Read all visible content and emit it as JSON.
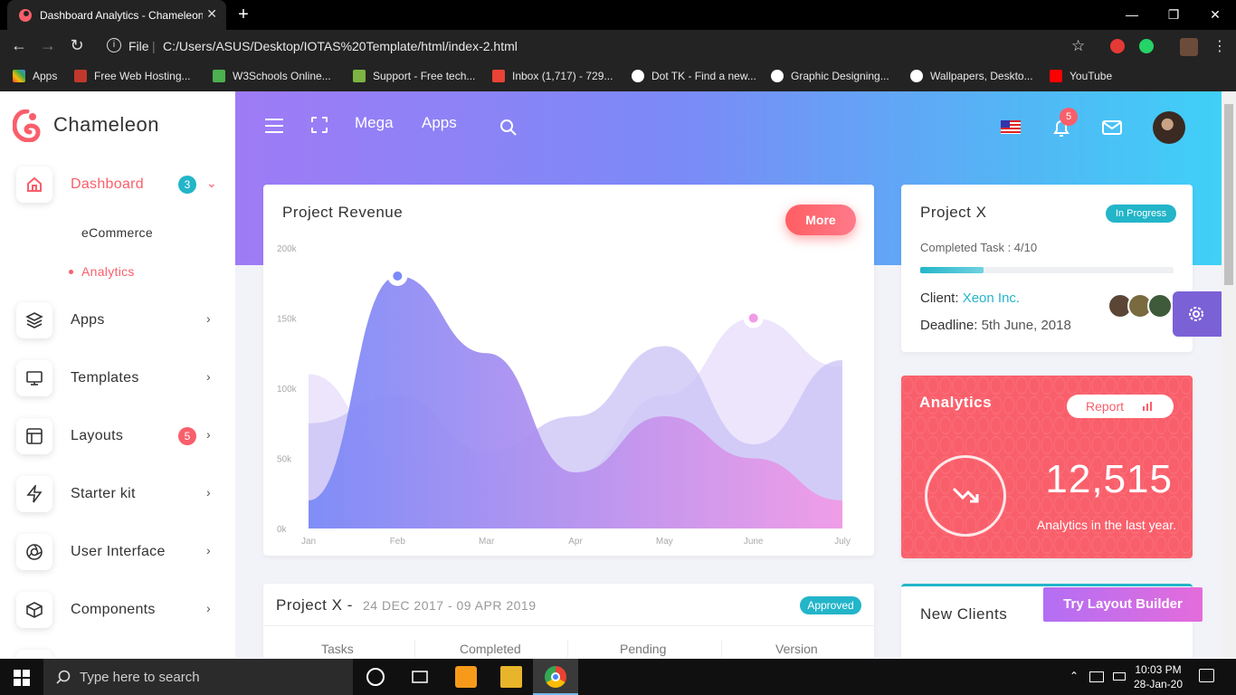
{
  "browser": {
    "tab_title": "Dashboard Analytics - Chameleon",
    "new_tab": "+",
    "close_tab": "✕",
    "omnibox_scheme": "File",
    "omnibox_url": "C:/Users/ASUS/Desktop/IOTAS%20Template/html/index-2.html",
    "bookmarks": [
      "Apps",
      "Free Web Hosting...",
      "W3Schools Online...",
      "Support - Free tech...",
      "Inbox (1,717) - 729...",
      "Dot TK - Find a new...",
      "Graphic Designing...",
      "Wallpapers, Deskto...",
      "YouTube"
    ]
  },
  "sidebar": {
    "brand": "Chameleon",
    "items": [
      {
        "label": "Dashboard",
        "badge": "3",
        "icon": "home-icon",
        "active": true
      },
      {
        "label": "Apps",
        "icon": "layers-icon"
      },
      {
        "label": "Templates",
        "icon": "monitor-icon"
      },
      {
        "label": "Layouts",
        "badge": "5",
        "icon": "layout-icon"
      },
      {
        "label": "Starter kit",
        "icon": "zap-icon"
      },
      {
        "label": "User Interface",
        "icon": "aperture-icon"
      },
      {
        "label": "Components",
        "icon": "box-icon"
      }
    ],
    "submenu": [
      "eCommerce",
      "Analytics"
    ]
  },
  "header": {
    "nav": [
      "Mega",
      "Apps"
    ],
    "notifications_count": "5"
  },
  "revenue": {
    "title": "Project Revenue",
    "more_label": "More"
  },
  "chart_data": {
    "type": "area",
    "title": "Project Revenue",
    "categories": [
      "Jan",
      "Feb",
      "Mar",
      "Apr",
      "May",
      "June",
      "July"
    ],
    "ylim": [
      0,
      200000
    ],
    "yticks": [
      "200k",
      "150k",
      "100k",
      "50k",
      "0k"
    ],
    "series": [
      {
        "values": [
          20000,
          180000,
          125000,
          40000,
          80000,
          50000,
          20000
        ],
        "color": "#7b8af7"
      },
      {
        "values": [
          75000,
          95000,
          55000,
          80000,
          130000,
          60000,
          120000
        ],
        "color": "#c9c1f5"
      },
      {
        "values": [
          110000,
          50000,
          40000,
          40000,
          95000,
          150000,
          115000
        ],
        "color": "#e6dcfb"
      }
    ]
  },
  "projectx": {
    "title": "Project X",
    "status": "In Progress",
    "task_label": "Completed Task : 4/10",
    "progress": 0.25,
    "client_label": "Client:",
    "client_value": "Xeon Inc.",
    "deadline_label": "Deadline:",
    "deadline_value": "5th June, 2018"
  },
  "analytics": {
    "title": "Analytics",
    "report_label": "Report",
    "value": "12,515",
    "caption": "Analytics in the last year."
  },
  "project_table": {
    "title": "Project X -",
    "dates": "24 DEC 2017 - 09 APR 2019",
    "status": "Approved",
    "columns": [
      "Tasks",
      "Completed",
      "Pending",
      "Version"
    ]
  },
  "new_clients": {
    "title": "New Clients"
  },
  "try_builder": "Try Layout Builder",
  "taskbar": {
    "search_placeholder": "Type here to search",
    "time": "10:03 PM",
    "date": "28-Jan-20"
  }
}
